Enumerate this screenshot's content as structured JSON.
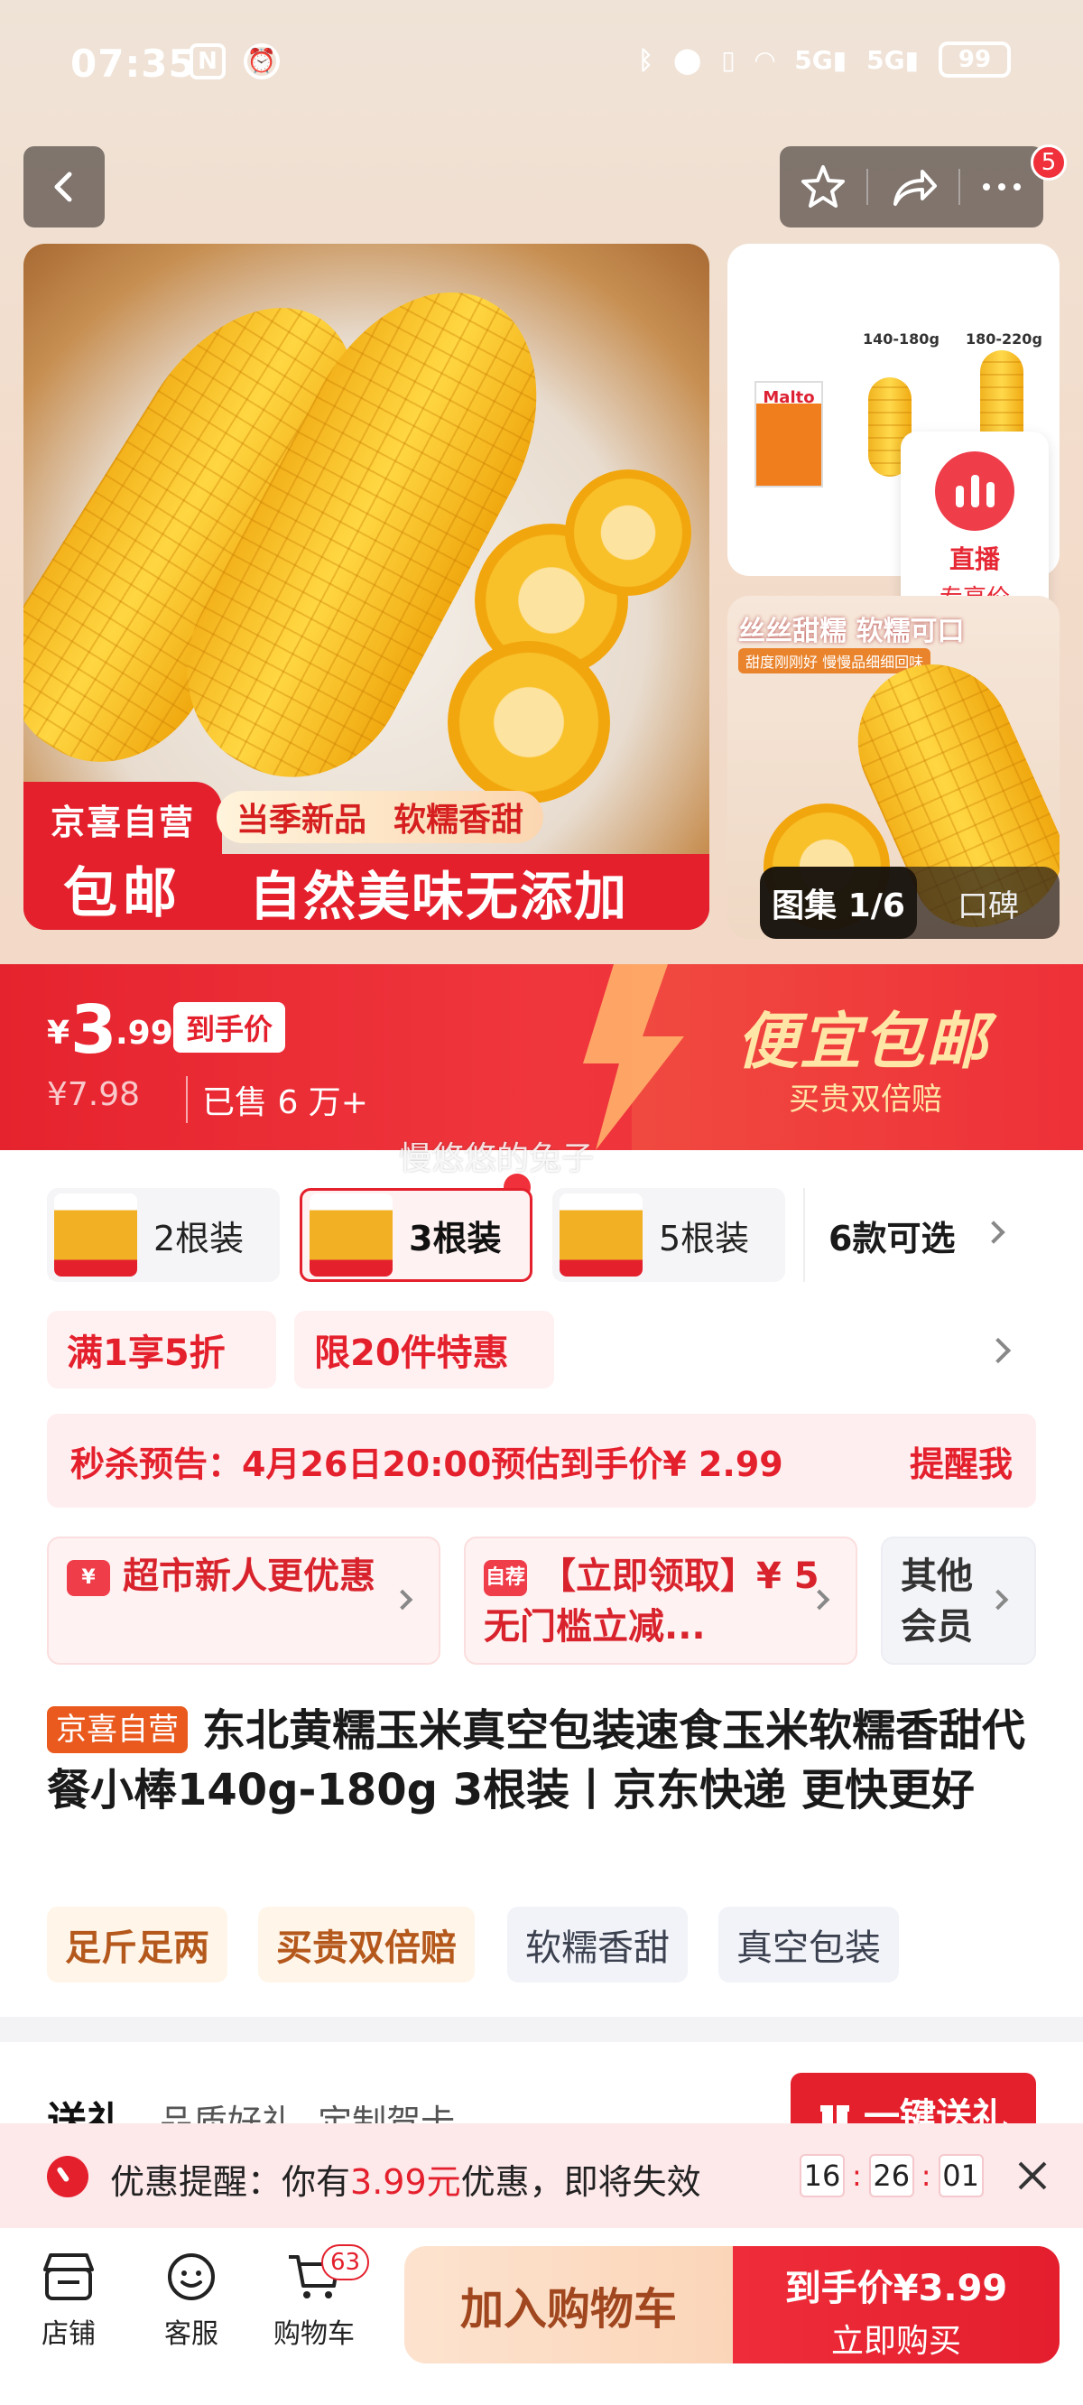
{
  "status_bar": {
    "time": "07:35",
    "battery": "99"
  },
  "header": {
    "notification_count": "5"
  },
  "gallery": {
    "main_badge_top": "京喜自营",
    "main_badge_bottom": "包邮",
    "main_tag_1": "当季新品",
    "main_tag_2": "软糯香甜",
    "main_banner": "自然美味无添加",
    "thumb1_brand": "Malto",
    "thumb1_weight_1": "140-180g",
    "thumb1_weight_2": "180-220g",
    "thumb2_title": "丝丝甜糯 软糯可口",
    "thumb2_sub": "甜度刚刚好 慢慢品细细回味",
    "live_label": "直播",
    "live_sub": "专享价",
    "gallery_label": "图集 1/6",
    "reviews_label": "口碑"
  },
  "price": {
    "currency": "¥",
    "int_part": "3",
    "dec_part": ".99",
    "tag": "到手价",
    "original": "¥7.98",
    "sold": "已售 6 万+",
    "promo_big": "便宜包邮",
    "promo_sub": "买贵双倍赔"
  },
  "danmu": "慢悠悠的兔子",
  "variants": [
    {
      "label": "2根装"
    },
    {
      "label": "3根装"
    },
    {
      "label": "5根装"
    }
  ],
  "variants_more": "6款可选",
  "promo_tags": [
    "满1享5折",
    "限20件特惠"
  ],
  "seckill": {
    "text": "秒杀预告：4月26日20:00预估到手价¥ 2.99",
    "action": "提醒我"
  },
  "coupons": [
    {
      "icon": "¥",
      "text": "超市新人更优惠"
    },
    {
      "icon": "自荐",
      "text": "【立即领取】¥ 5 无门槛立减..."
    },
    {
      "text": "其他会员"
    }
  ],
  "product": {
    "tag": "京喜自营",
    "title": "东北黄糯玉米真空包装速食玉米软糯香甜代餐小棒140g-180g 3根装丨京东快递 更快更好"
  },
  "features": [
    "足斤足两",
    "买贵双倍赔",
    "软糯香甜",
    "真空包装"
  ],
  "gift": {
    "title": "送礼",
    "sub": "品质好礼, 定制贺卡",
    "button": "一键送礼"
  },
  "reminder": {
    "prefix": "优惠提醒：你有",
    "amount": "3.99元",
    "suffix": "优惠，即将失效",
    "hh": "16",
    "mm": "26",
    "ss": "01"
  },
  "bottom_nav": {
    "store": "店铺",
    "service": "客服",
    "cart": "购物车",
    "cart_count": "63",
    "add_to_cart": "加入购物车",
    "buy_price_label": "到手价¥3.99",
    "buy_now": "立即购买"
  }
}
